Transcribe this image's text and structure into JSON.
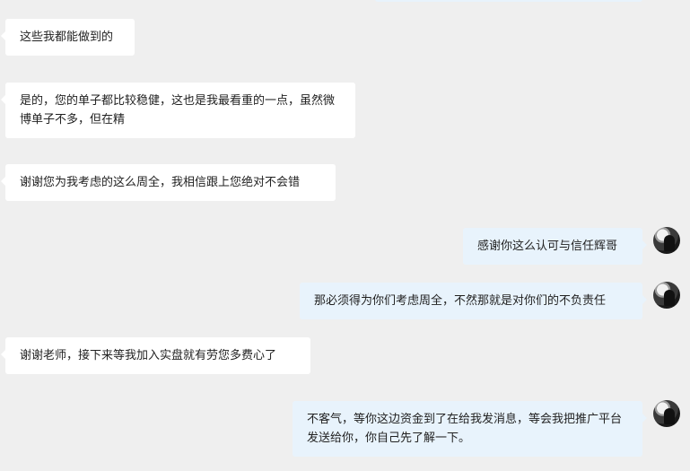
{
  "messages": [
    {
      "side": "in",
      "text": "这些我都能做到的"
    },
    {
      "side": "in",
      "text": "是的，您的单子都比较稳健，这也是我最看重的一点，虽然微博单子不多，但在精"
    },
    {
      "side": "in",
      "text": "谢谢您为我考虑的这么周全，我相信跟上您绝对不会错"
    },
    {
      "side": "out",
      "text": "感谢你这么认可与信任辉哥"
    },
    {
      "side": "out",
      "text": "那必须得为你们考虑周全，不然那就是对你们的不负责任"
    },
    {
      "side": "in",
      "text": "谢谢老师，接下来等我加入实盘就有劳您多费心了"
    },
    {
      "side": "out",
      "text": "不客气，等你这边资金到了在给我发消息，等会我把推广平台发送给你，你自己先了解一下。"
    }
  ]
}
